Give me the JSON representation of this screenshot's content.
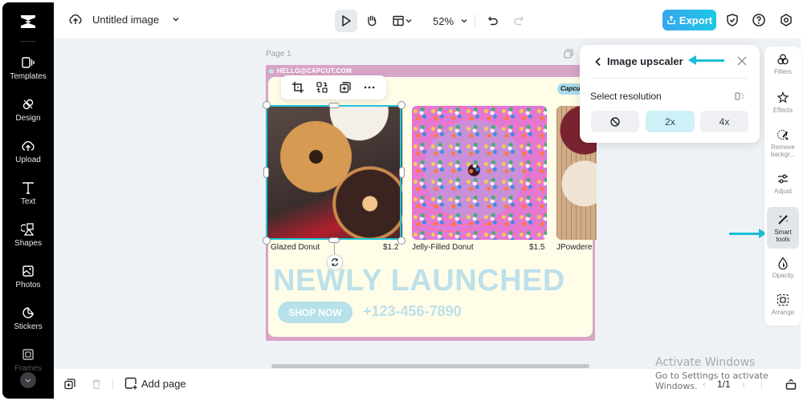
{
  "app": {
    "document_title": "Untitled image"
  },
  "sidebar": {
    "items": [
      {
        "label": "Templates",
        "icon": "templates-icon"
      },
      {
        "label": "Design",
        "icon": "design-icon"
      },
      {
        "label": "Upload",
        "icon": "upload-icon"
      },
      {
        "label": "Text",
        "icon": "text-icon"
      },
      {
        "label": "Shapes",
        "icon": "shapes-icon"
      },
      {
        "label": "Photos",
        "icon": "photos-icon"
      },
      {
        "label": "Stickers",
        "icon": "stickers-icon"
      },
      {
        "label": "Frames",
        "icon": "frames-icon"
      }
    ]
  },
  "toolbar": {
    "zoom_level": "52%",
    "export_label": "Export"
  },
  "canvas": {
    "page_label": "Page 1",
    "design": {
      "email": "HELLO@CAPCUT.COM",
      "brand": "Capcut",
      "products": [
        {
          "name": "Glazed Donut",
          "price": "$1.2"
        },
        {
          "name": "Jelly-Filled Donut",
          "price": "$1.5"
        },
        {
          "name": "JPowdere",
          "price": ""
        }
      ],
      "headline": "NEWLY LAUNCHED",
      "cta": "SHOP NOW",
      "phone": "+123-456-7890"
    }
  },
  "upscaler_panel": {
    "title": "Image upscaler",
    "resolution_label": "Select resolution",
    "options": [
      {
        "label": "",
        "icon": "no-upscale-icon",
        "selected": false
      },
      {
        "label": "2x",
        "selected": true
      },
      {
        "label": "4x",
        "selected": false
      }
    ]
  },
  "right_tools": {
    "items": [
      {
        "label": "Filters",
        "active": false
      },
      {
        "label": "Effects",
        "active": false
      },
      {
        "label": "Remove backgr...",
        "active": false
      },
      {
        "label": "Adjust",
        "active": false
      },
      {
        "label": "Smart tools",
        "active": true
      },
      {
        "label": "Opacity",
        "active": false
      },
      {
        "label": "Arrange",
        "active": false
      }
    ]
  },
  "bottom": {
    "add_page_label": "Add page",
    "page_indicator": "1/1"
  },
  "watermark": {
    "line1": "Activate Windows",
    "line2": "Go to Settings to activate Windows."
  },
  "colors": {
    "accent": "#1fc3d9",
    "export_start": "#37a6ef",
    "export_end": "#1dc7e6",
    "design_border": "#d8a4c8",
    "design_bg": "#fffde8",
    "headline": "#bde0ea"
  }
}
